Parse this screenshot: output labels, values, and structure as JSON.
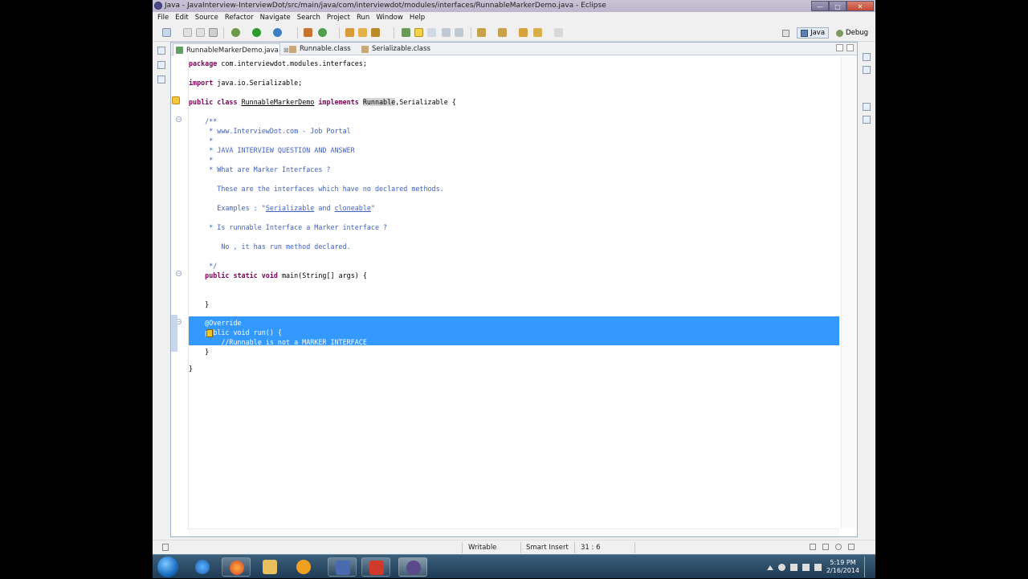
{
  "window": {
    "title": "Java - JavaInterview-InterviewDot/src/main/java/com/interviewdot/modules/interfaces/RunnableMarkerDemo.java - Eclipse",
    "minimize": "—",
    "maximize": "□",
    "close": "✕"
  },
  "menu": [
    "File",
    "Edit",
    "Source",
    "Refactor",
    "Navigate",
    "Search",
    "Project",
    "Run",
    "Window",
    "Help"
  ],
  "perspectives": {
    "java": "Java",
    "debug": "Debug"
  },
  "tabs": [
    {
      "label": "RunnableMarkerDemo.java",
      "close": "⊠",
      "active": true
    },
    {
      "label": "Runnable.class",
      "active": false
    },
    {
      "label": "Serializable.class",
      "active": false
    }
  ],
  "code": {
    "l1_kw": "package",
    "l1_rest": " com.interviewdot.modules.interfaces;",
    "l2_kw": "import",
    "l2_rest": " java.io.Serializable;",
    "l3_kw1": "public class",
    "l3_name": "RunnableMarkerDemo",
    "l3_kw2": "implements",
    "l3_iface": "Runnable",
    "l3_rest": ",Serializable {",
    "jd1": "    /**",
    "jd2": "     * www.InterviewDot.com - Job Portal",
    "jd3": "     *",
    "jd4": "     * JAVA INTERVIEW QUESTION AND ANSWER",
    "jd5": "     *",
    "jd6": "     * What are Marker Interfaces ?",
    "jd7": "       These are the interfaces which have no declared methods.",
    "jd8a": "       Examples : \"",
    "jd8b": "Serializable",
    "jd8c": " and ",
    "jd8d": "cloneable",
    "jd8e": "\"",
    "jd9": "     * Is runnable Interface a Marker interface ?",
    "jd10": "        No , it has run method declared.",
    "jd11": "     */",
    "main_kw": "    public static void",
    "main_rest": " main(String[] args) {",
    "close1": "    }",
    "ann": "    @Override",
    "run_kw": "    public void",
    "run_rest": " run() {",
    "comment": "        //Runnable is not a MARKER INTERFACE",
    "close2": "    }",
    "close3": "}"
  },
  "status": {
    "writable": "Writable",
    "insert": "Smart Insert",
    "position": "31 : 6"
  },
  "clock": {
    "time": "5:19 PM",
    "date": "2/16/2014"
  }
}
